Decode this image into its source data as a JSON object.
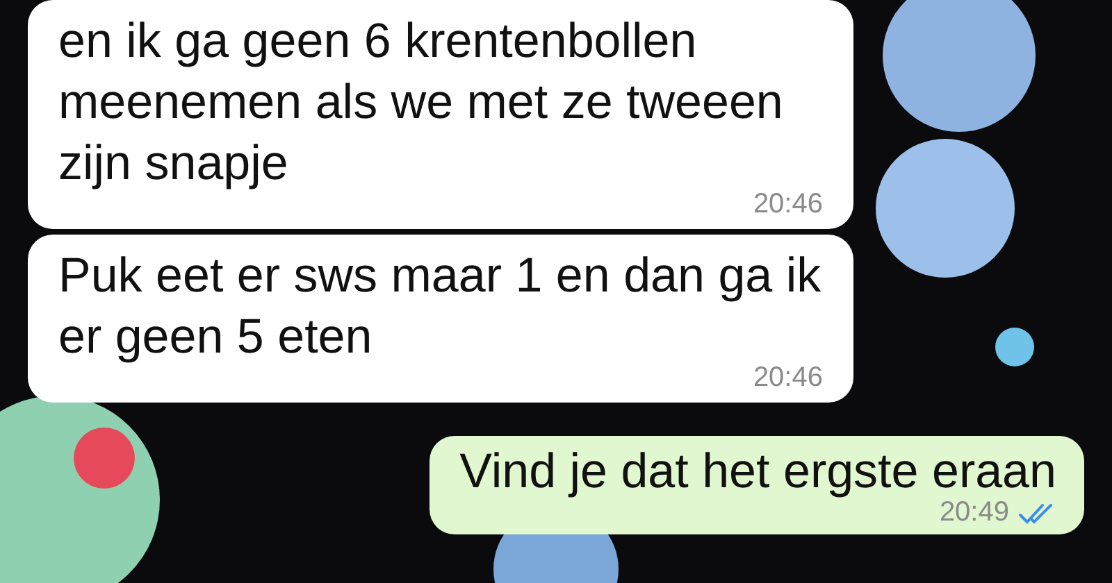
{
  "messages": [
    {
      "kind": "incoming",
      "text": "en ik ga geen 6 krentenbollen meenemen als we met ze tweeen zijn snapje",
      "time": "20:46"
    },
    {
      "kind": "incoming",
      "text": "Puk eet er sws maar 1 en dan ga ik er geen 5 eten",
      "time": "20:46"
    },
    {
      "kind": "outgoing",
      "text": "Vind je dat het ergste eraan",
      "time": "20:49",
      "read": true
    }
  ]
}
